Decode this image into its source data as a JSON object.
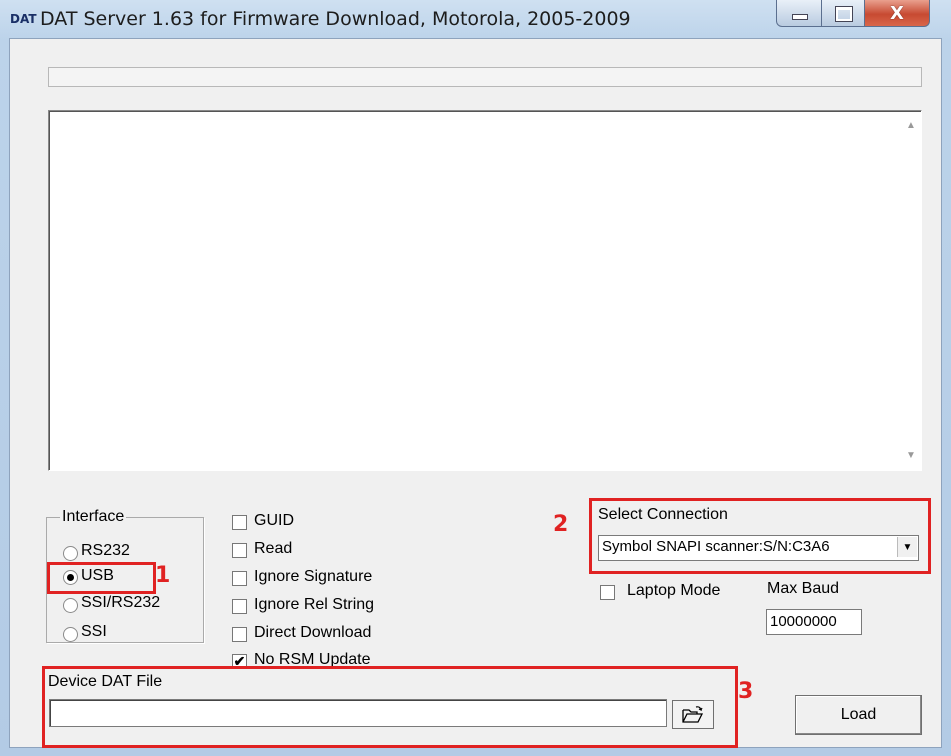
{
  "window": {
    "app_icon_text": "DAT",
    "title": "DAT Server 1.63 for Firmware Download, Motorola, 2005-2009",
    "close_glyph": "X"
  },
  "interface": {
    "label": "Interface",
    "options": [
      "RS232",
      "USB",
      "SSI/RS232",
      "SSI"
    ],
    "selected": "USB"
  },
  "options": {
    "guid": {
      "label": "GUID",
      "checked": false
    },
    "read": {
      "label": "Read",
      "checked": false
    },
    "ignore_signature": {
      "label": "Ignore Signature",
      "checked": false
    },
    "ignore_rel_string": {
      "label": "Ignore Rel String",
      "checked": false
    },
    "direct_download": {
      "label": "Direct Download",
      "checked": false
    },
    "no_rsm_update": {
      "label": "No RSM Update",
      "checked": true
    },
    "check_glyph": "✔"
  },
  "connection": {
    "label": "Select Connection",
    "value": "Symbol SNAPI scanner:S/N:C3A6",
    "laptop_mode_label": "Laptop Mode",
    "laptop_mode_checked": false,
    "max_baud_label": "Max Baud",
    "max_baud_value": "10000000"
  },
  "device_file": {
    "label": "Device DAT File",
    "value": ""
  },
  "load_label": "Load",
  "annotations": [
    "1",
    "2",
    "3"
  ],
  "colors": {
    "annotation": "#e02222",
    "close_button": "#c74a32"
  }
}
